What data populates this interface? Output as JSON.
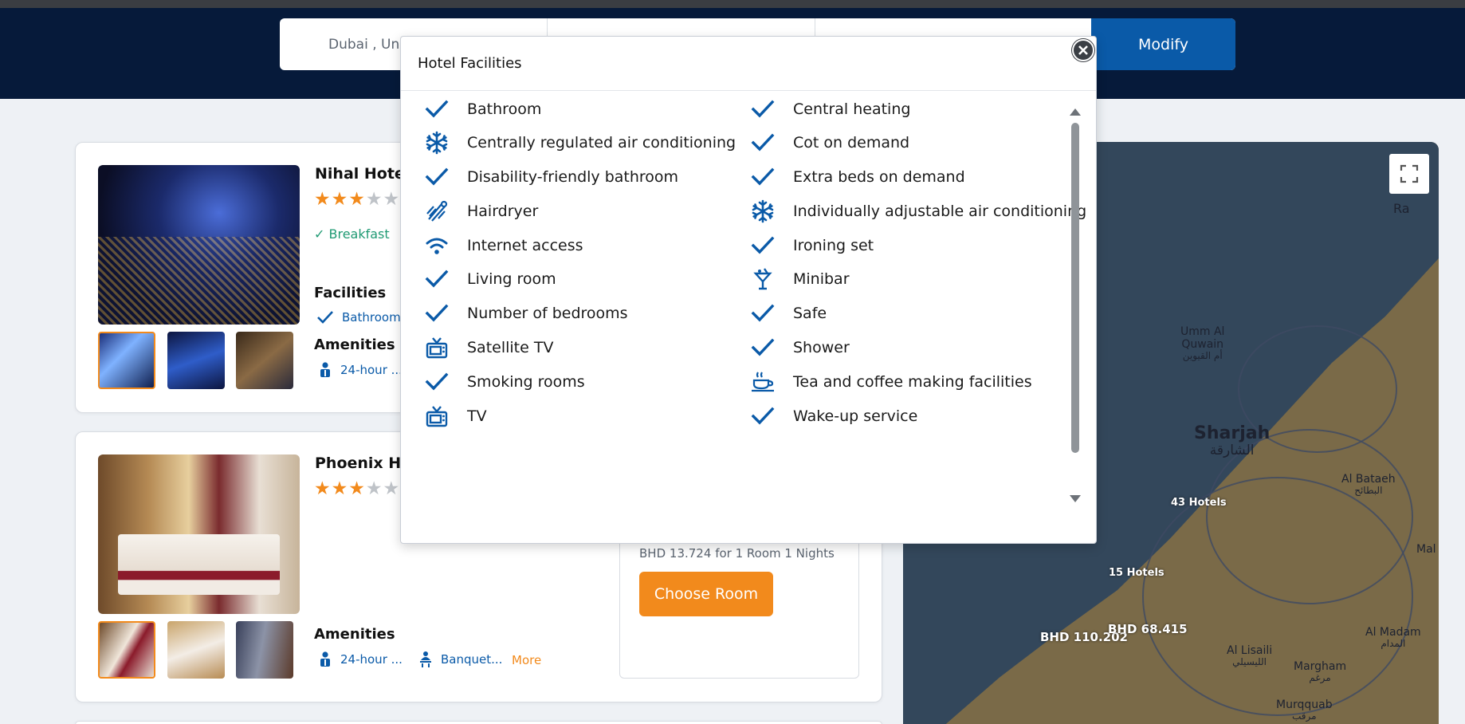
{
  "search": {
    "destination": "Dubai , Uni",
    "dates": "",
    "guests": "",
    "modify_label": "Modify"
  },
  "hotels": [
    {
      "name": "Nihal Hotel",
      "stars": 3,
      "breakfast": "Breakfast",
      "facilities_title": "Facilities",
      "facility_preview": "Bathroom",
      "amenities_title": "Amenities",
      "amenity_1": "24-hour ..."
    },
    {
      "name": "Phoenix Hot",
      "stars": 3,
      "amenities_title": "Amenities",
      "amenity_1": "24-hour ...",
      "amenity_2": "Banquet...",
      "more": "More",
      "price_currency": "BHD",
      "price_value": "13.724",
      "price_suffix": "for 1 Room 1 Nights",
      "choose_label": "Choose Room"
    }
  ],
  "map": {
    "places": {
      "umm_al_quwain": "Umm Al\nQuwain",
      "umm_al_quwain_ar": "أم القيوين",
      "sharjah": "Sharjah",
      "sharjah_ar": "الشارقة",
      "al_bataeh": "Al Bataeh",
      "al_bataeh_ar": "البطائح",
      "al_lisaili": "Al Lisaili",
      "al_lisaili_ar": "الليسيلي",
      "margham": "Margham",
      "margham_ar": "مرغم",
      "al_madam": "Al Madam",
      "al_madam_ar": "المدام",
      "murqquab": "Murqquab",
      "murqquab_ar": "مرقب",
      "ras": "Ra",
      "mal": "Mal"
    },
    "clusters": [
      "43 Hotels",
      "15 Hotels"
    ],
    "price_pins": [
      "BHD 110.202",
      "BHD 68.415"
    ]
  },
  "modal": {
    "title": "Hotel Facilities",
    "left": [
      {
        "label": "Bathroom",
        "icon": "check-icon"
      },
      {
        "label": "Centrally regulated air conditioning",
        "icon": "snowflake-icon"
      },
      {
        "label": "Disability-friendly bathroom",
        "icon": "check-icon"
      },
      {
        "label": "Hairdryer",
        "icon": "hairdryer-icon"
      },
      {
        "label": "Internet access",
        "icon": "wifi-icon"
      },
      {
        "label": "Living room",
        "icon": "check-icon"
      },
      {
        "label": "Number of bedrooms",
        "icon": "check-icon"
      },
      {
        "label": "Satellite TV",
        "icon": "tv-icon"
      },
      {
        "label": "Smoking rooms",
        "icon": "check-icon"
      },
      {
        "label": "TV",
        "icon": "tv-icon"
      }
    ],
    "right": [
      {
        "label": "Central heating",
        "icon": "check-icon"
      },
      {
        "label": "Cot on demand",
        "icon": "check-icon"
      },
      {
        "label": "Extra beds on demand",
        "icon": "check-icon"
      },
      {
        "label": "Individually adjustable air conditioning",
        "icon": "snowflake-icon"
      },
      {
        "label": "Ironing set",
        "icon": "check-icon"
      },
      {
        "label": "Minibar",
        "icon": "cocktail-icon"
      },
      {
        "label": "Safe",
        "icon": "check-icon"
      },
      {
        "label": "Shower",
        "icon": "check-icon"
      },
      {
        "label": "Tea and coffee making facilities",
        "icon": "teacup-icon"
      },
      {
        "label": "Wake-up service",
        "icon": "check-icon"
      }
    ]
  },
  "colors": {
    "brand_blue": "#0a5aa8",
    "header_navy": "#061a3a",
    "accent_orange": "#f28a1c",
    "breakfast_green": "#1f9a73"
  }
}
